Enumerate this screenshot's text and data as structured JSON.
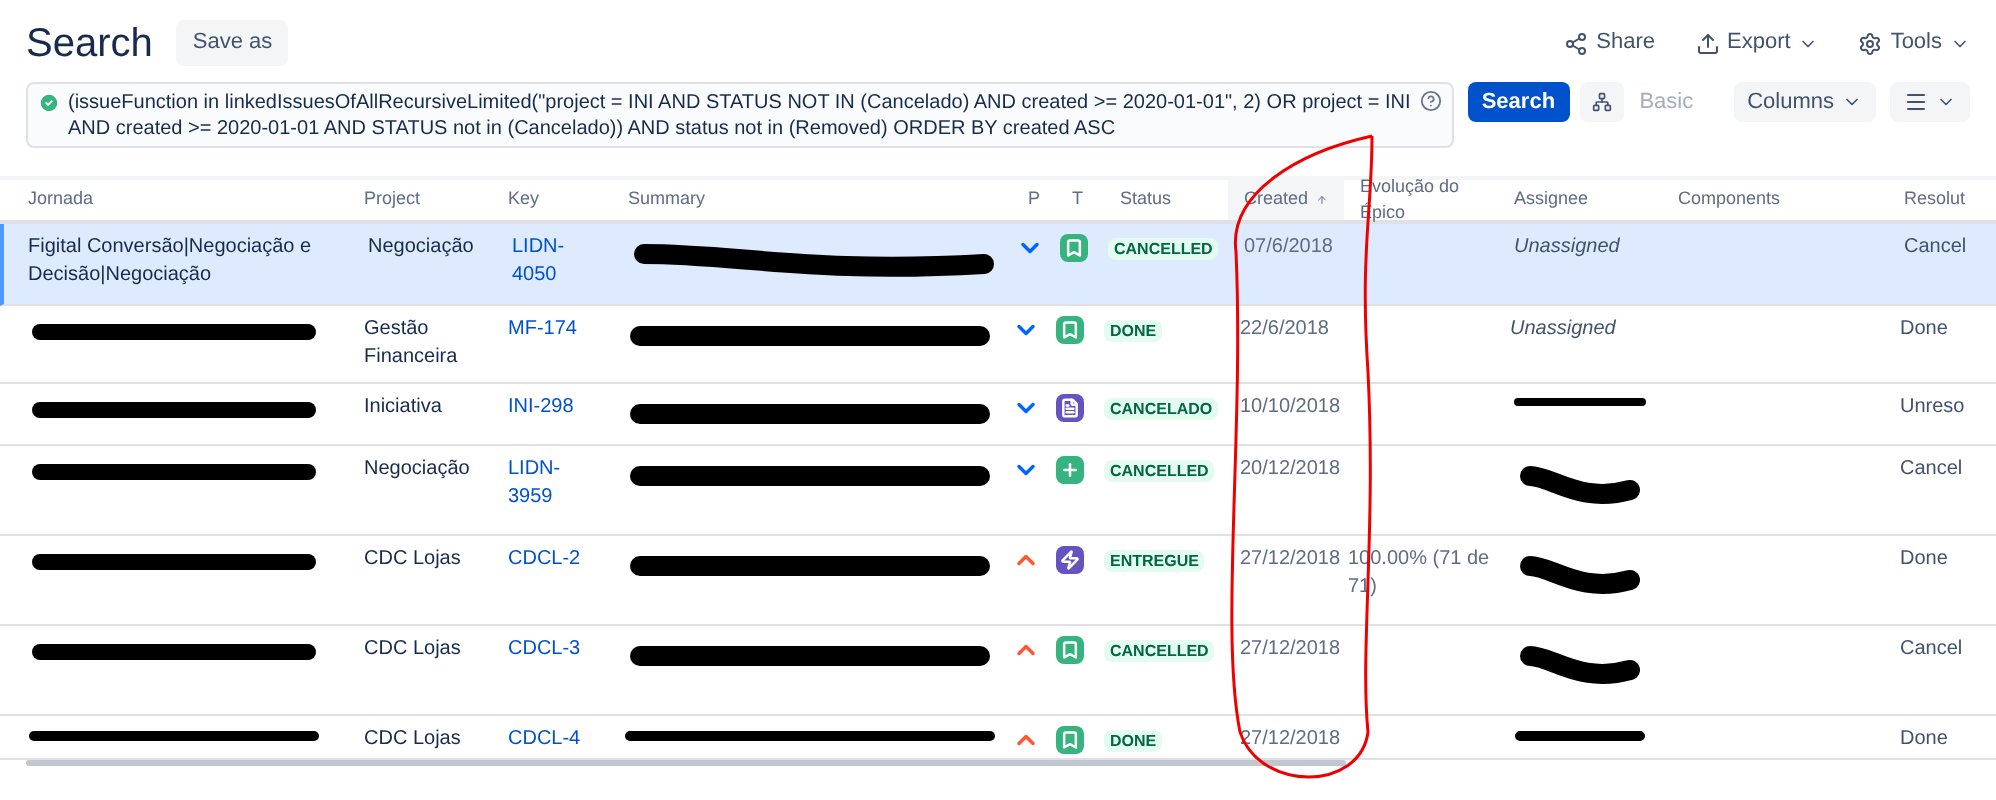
{
  "header": {
    "title": "Search",
    "save_as": "Save as",
    "actions": [
      {
        "kind": "share",
        "label": "Share"
      },
      {
        "kind": "export",
        "label": "Export"
      },
      {
        "kind": "tools",
        "label": "Tools"
      }
    ]
  },
  "query": {
    "valid": true,
    "text": "(issueFunction in linkedIssuesOfAllRecursiveLimited(\"project = INI AND STATUS NOT IN (Cancelado) AND created >= 2020-01-01\", 2) OR project = INI AND created >= 2020-01-01 AND STATUS not in (Cancelado)) AND status not in (Removed) ORDER BY created ASC",
    "search_button": "Search",
    "basic_link": "Basic",
    "columns_button": "Columns"
  },
  "table": {
    "columns": [
      {
        "label": "Jornada"
      },
      {
        "label": "Project"
      },
      {
        "label": "Key"
      },
      {
        "label": "Summary"
      },
      {
        "label": "P"
      },
      {
        "label": "T"
      },
      {
        "label": "Status"
      },
      {
        "label": "Created",
        "sorted": true
      },
      {
        "label": "Evolução do Épico"
      },
      {
        "label": "Assignee"
      },
      {
        "label": "Components"
      },
      {
        "label": "Resolut"
      }
    ],
    "rows": [
      {
        "selected": true,
        "jornada": "Figital Conversão|Negociação e Decisão|Negociação",
        "project": "Negociação",
        "key": "LIDN-4050",
        "high_priority": false,
        "kind": "story",
        "status": "CANCELLED",
        "created": "07/6/2018",
        "assignee": "Unassigned",
        "resolution": "Cancel"
      },
      {
        "selected": false,
        "project": "Gestão Financeira",
        "key": "MF-174",
        "high_priority": false,
        "kind": "story",
        "status": "DONE",
        "created": "22/6/2018",
        "assignee": "Unassigned",
        "resolution": "Done"
      },
      {
        "selected": false,
        "project": "Iniciativa",
        "key": "INI-298",
        "high_priority": false,
        "kind": "task",
        "status": "CANCELADO",
        "created": "10/10/2018",
        "resolution": "Unreso"
      },
      {
        "selected": false,
        "project": "Negociação",
        "key": "LIDN-3959",
        "high_priority": false,
        "kind": "feature",
        "status": "CANCELLED",
        "created": "20/12/2018",
        "resolution": "Cancel"
      },
      {
        "selected": false,
        "project": "CDC Lojas",
        "key": "CDCL-2",
        "high_priority": true,
        "kind": "epic",
        "status": "ENTREGUE",
        "created": "27/12/2018",
        "evolucao": "100.00% (71 de 71)",
        "resolution": "Done"
      },
      {
        "selected": false,
        "project": "CDC Lojas",
        "key": "CDCL-3",
        "high_priority": true,
        "kind": "story",
        "status": "CANCELLED",
        "created": "27/12/2018",
        "resolution": "Cancel"
      },
      {
        "selected": false,
        "project": "CDC Lojas",
        "key": "CDCL-4",
        "high_priority": true,
        "kind": "story",
        "status": "DONE",
        "created": "27/12/2018",
        "resolution": "Done"
      }
    ]
  }
}
